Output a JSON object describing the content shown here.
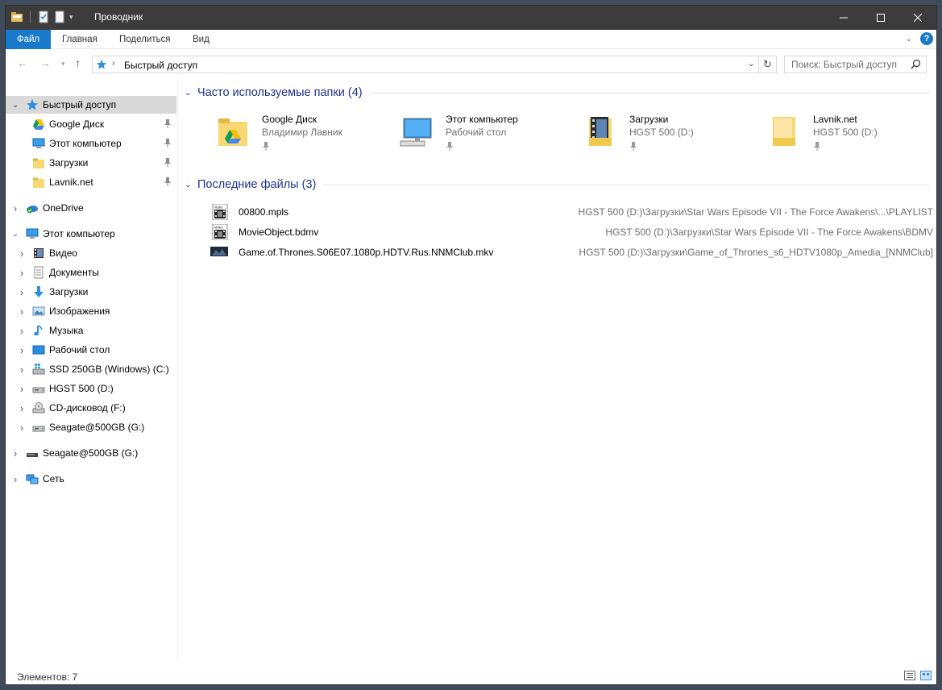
{
  "window": {
    "title": "Проводник"
  },
  "ribbon": {
    "tabs": [
      "Файл",
      "Главная",
      "Поделиться",
      "Вид"
    ]
  },
  "address": {
    "crumb": "Быстрый доступ"
  },
  "search": {
    "placeholder": "Поиск: Быстрый доступ"
  },
  "sidebar": {
    "items": [
      {
        "label": "Быстрый доступ",
        "icon": "star-icon",
        "level": 0,
        "expanded": true,
        "selected": true
      },
      {
        "label": "Google Диск",
        "icon": "google-drive-icon",
        "level": 1,
        "pinned": true
      },
      {
        "label": "Этот компьютер",
        "icon": "computer-icon",
        "level": 1,
        "pinned": true
      },
      {
        "label": "Загрузки",
        "icon": "folder-icon",
        "level": 1,
        "pinned": true
      },
      {
        "label": "Lavnik.net",
        "icon": "folder-icon",
        "level": 1,
        "pinned": true
      },
      {
        "label": "OneDrive",
        "icon": "onedrive-icon",
        "level": 0,
        "collapsed": true
      },
      {
        "label": "Этот компьютер",
        "icon": "computer-icon",
        "level": 0,
        "expanded": true
      },
      {
        "label": "Видео",
        "icon": "video-folder-icon",
        "level": 1,
        "collapsed": true
      },
      {
        "label": "Документы",
        "icon": "documents-icon",
        "level": 1,
        "collapsed": true
      },
      {
        "label": "Загрузки",
        "icon": "download-icon",
        "level": 1,
        "collapsed": true
      },
      {
        "label": "Изображения",
        "icon": "pictures-icon",
        "level": 1,
        "collapsed": true
      },
      {
        "label": "Музыка",
        "icon": "music-icon",
        "level": 1,
        "collapsed": true
      },
      {
        "label": "Рабочий стол",
        "icon": "desktop-icon",
        "level": 1,
        "collapsed": true
      },
      {
        "label": "SSD 250GB (Windows) (C:)",
        "icon": "windows-drive-icon",
        "level": 1,
        "collapsed": true
      },
      {
        "label": "HGST 500 (D:)",
        "icon": "drive-icon",
        "level": 1,
        "collapsed": true
      },
      {
        "label": "CD-дисковод (F:)",
        "icon": "cd-drive-icon",
        "level": 1,
        "collapsed": true
      },
      {
        "label": "Seagate@500GB (G:)",
        "icon": "drive-icon",
        "level": 1,
        "collapsed": true
      },
      {
        "label": "Seagate@500GB (G:)",
        "icon": "usb-drive-icon",
        "level": 0,
        "collapsed": true
      },
      {
        "label": "Сеть",
        "icon": "network-icon",
        "level": 0,
        "collapsed": true
      }
    ]
  },
  "frequent": {
    "title": "Часто используемые папки (4)",
    "tiles": [
      {
        "name": "Google Диск",
        "sub": "Владимир Лавник",
        "icon": "google-drive-folder-icon"
      },
      {
        "name": "Этот компьютер",
        "sub": "Рабочий стол",
        "icon": "computer-icon"
      },
      {
        "name": "Загрузки",
        "sub": "HGST 500 (D:)",
        "icon": "video-folder-icon"
      },
      {
        "name": "Lavnik.net",
        "sub": "HGST 500 (D:)",
        "icon": "folder-icon"
      }
    ]
  },
  "recent": {
    "title": "Последние файлы (3)",
    "files": [
      {
        "name": "00800.mpls",
        "path": "HGST 500 (D:)\\Загрузки\\Star Wars Episode VII - The Force Awakens\\...\\PLAYLIST",
        "icon": "video-file-icon"
      },
      {
        "name": "MovieObject.bdmv",
        "path": "HGST 500 (D:)\\Загрузки\\Star Wars Episode VII - The Force Awakens\\BDMV",
        "icon": "video-file-icon"
      },
      {
        "name": "Game.of.Thrones.S06E07.1080p.HDTV.Rus.NNMClub.mkv",
        "path": "HGST 500 (D:)\\Загрузки\\Game_of_Thrones_s6_HDTV1080p_Amedia_[NNMClub]",
        "icon": "video-thumbnail-icon"
      }
    ]
  },
  "status": {
    "text": "Элементов: 7"
  },
  "colors": {
    "accent": "#1979ca",
    "titlebar": "#3c3c3c",
    "group_header": "#1e3287",
    "selection": "#d9d9d9"
  }
}
